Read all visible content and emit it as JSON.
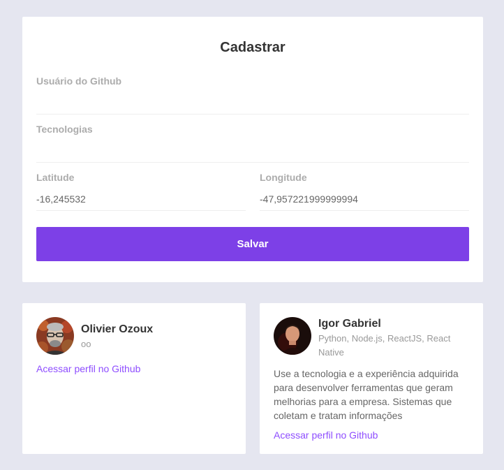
{
  "form": {
    "title": "Cadastrar",
    "github_username": {
      "label": "Usuário do Github",
      "value": ""
    },
    "techs": {
      "label": "Tecnologias",
      "value": ""
    },
    "latitude": {
      "label": "Latitude",
      "value": "-16,245532"
    },
    "longitude": {
      "label": "Longitude",
      "value": "-47,957221999999994"
    },
    "save_label": "Salvar"
  },
  "colors": {
    "background": "#e5e6f0",
    "accent": "#7d40e7",
    "link": "#8e4dff"
  },
  "devs": [
    {
      "name": "Olivier Ozoux",
      "techs": "oo",
      "bio": "",
      "link_label": "Acessar perfil no Github"
    },
    {
      "name": "Igor Gabriel",
      "techs": "Python, Node.js, ReactJS, React Native",
      "bio": "Use a tecnologia e a experiência adquirida para desenvolver ferramentas que geram melhorias para a empresa. Sistemas que coletam e tratam informações",
      "link_label": "Acessar perfil no Github"
    }
  ]
}
